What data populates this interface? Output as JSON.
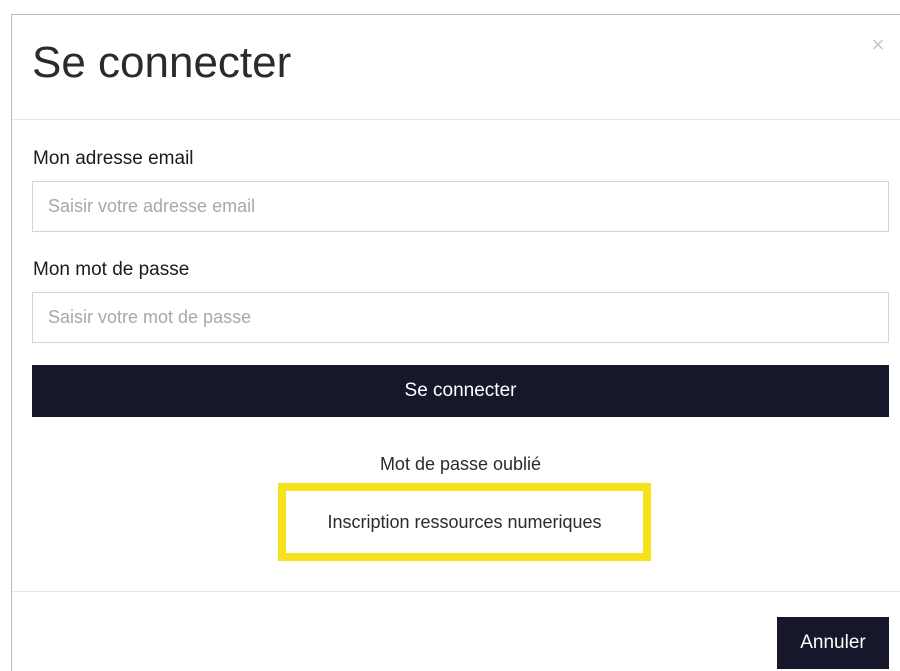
{
  "dialog": {
    "title": "Se connecter",
    "close_symbol": "×"
  },
  "form": {
    "email": {
      "label": "Mon adresse email",
      "placeholder": "Saisir votre adresse email",
      "value": ""
    },
    "password": {
      "label": "Mon mot de passe",
      "placeholder": "Saisir votre mot de passe",
      "value": ""
    },
    "submit_label": "Se connecter"
  },
  "links": {
    "forgot_password": "Mot de passe oublié",
    "signup_digital_resources": "Inscription ressources numeriques"
  },
  "footer": {
    "cancel_label": "Annuler"
  },
  "colors": {
    "primary_button": "#16172a",
    "highlight": "#f6e21a",
    "placeholder_text": "#a8a8a8"
  }
}
